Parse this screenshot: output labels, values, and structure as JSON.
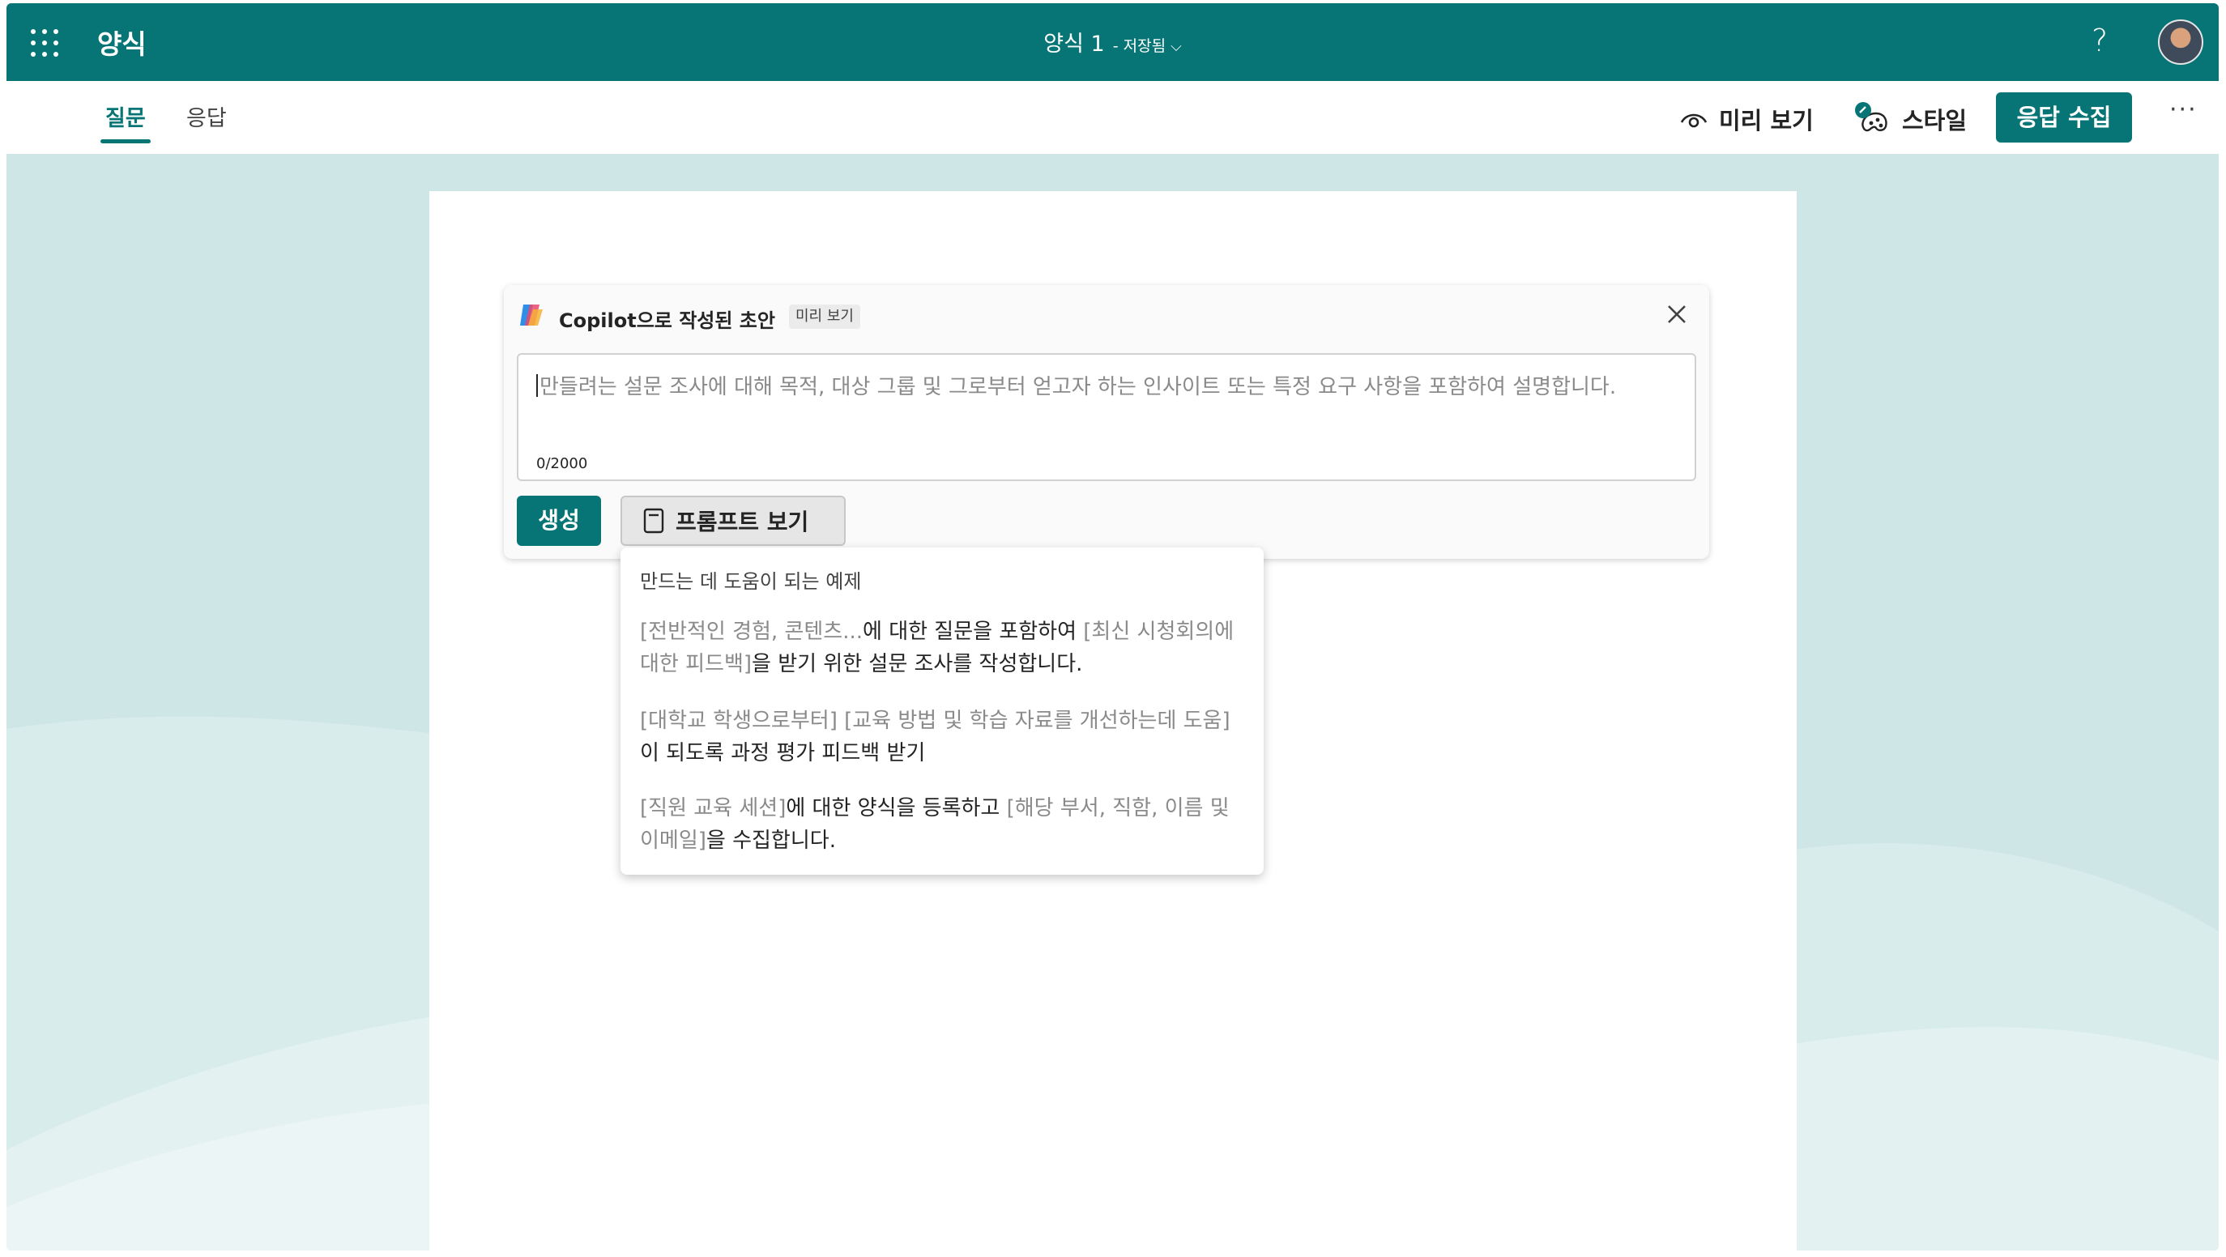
{
  "app": {
    "name": "양식"
  },
  "document": {
    "title": "양식 1",
    "status": "- 저장됨"
  },
  "tabs": [
    {
      "label": "질문",
      "active": true
    },
    {
      "label": "응답",
      "active": false
    }
  ],
  "toolbar": {
    "preview_label": "미리 보기",
    "style_label": "스타일",
    "collect_label": "응답 수집",
    "more_label": "···"
  },
  "help_label": "?",
  "copilot": {
    "title": "Copilot으로 작성된 초안",
    "badge": "미리 보기",
    "placeholder": "만들려는 설문 조사에 대해 목적, 대상 그룹 및 그로부터 얻고자 하는 인사이트 또는 특정 요구 사항을 포함하여 설명합니다.",
    "counter": "0/2000",
    "generate_label": "생성",
    "prompts_label": "프롬프트 보기"
  },
  "examples": {
    "heading": "만드는 데 도움이 되는 예제",
    "items": [
      {
        "p1": "[전반적인 경험, 콘텐츠...",
        "t1": "에 대한 질문을 포함하여 ",
        "p2": "[최신 시청회의에 대한 피드백]",
        "t2": "을 받기 위한 설문 조사를 작성합니다."
      },
      {
        "p1": "[대학교 학생으로부터] ",
        "t1": "",
        "p2": "[교육 방법 및 학습 자료를 개선하는데 도움]",
        "t2": "이 되도록 과정 평가 피드백 받기"
      },
      {
        "p1": "[직원 교육 세션]",
        "t1": "에 대한 양식을 등록하고 ",
        "p2": "[해당 부서, 직함, 이름 및 이메일]",
        "t2": "을 수집합니다."
      }
    ]
  },
  "colors": {
    "brand": "#077575",
    "background": "#cfe6e6",
    "placeholder": "#8a8a8a"
  },
  "icons": [
    "waffle-icon",
    "help-icon",
    "eye-icon",
    "palette-icon",
    "copilot-icon",
    "close-icon",
    "notebook-icon",
    "chevron-down-icon"
  ]
}
